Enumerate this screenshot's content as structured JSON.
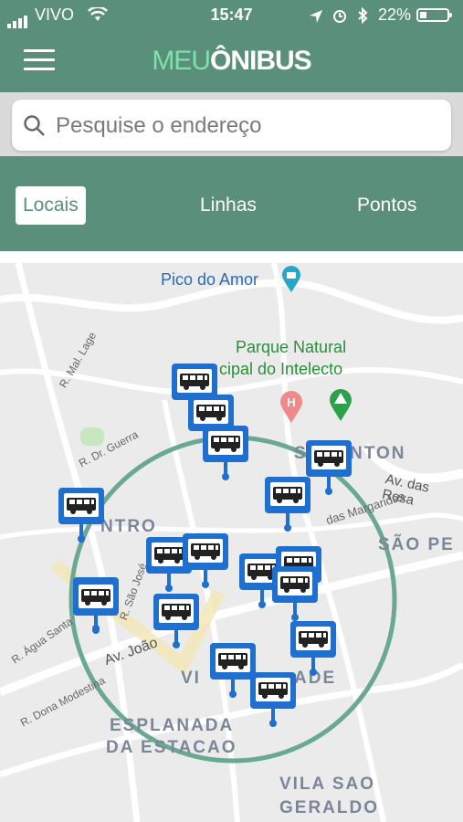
{
  "status_bar": {
    "carrier": "VIVO",
    "time": "15:47",
    "battery_percent": "22%"
  },
  "header": {
    "logo_part1": "MEU",
    "logo_part2": "ÔNIBUS",
    "background": "#5a8f7b",
    "logo_accent": "#7ee2a8"
  },
  "search": {
    "placeholder": "Pesquise o endereço",
    "value": ""
  },
  "tabs": [
    {
      "label": "Locais",
      "active": true
    },
    {
      "label": "Linhas",
      "active": false
    },
    {
      "label": "Pontos",
      "active": false
    }
  ],
  "map": {
    "poi_labels": [
      "Pico do Amor",
      "Parque Natural",
      "cipal do Intelecto"
    ],
    "street_labels": [
      "R. Mal. Lage",
      "R. Dr. Guerra",
      "R. São José",
      "Av. João",
      "R. Água Santa",
      "R. Dona Modestina",
      "Av. das Rosa",
      "das Margaridas"
    ],
    "area_labels": [
      "S  O ANTON",
      "NTRO",
      "SÃO PE",
      "VI",
      "ADE",
      "ESPLANADA",
      "DA ESTACAO",
      "VILA SAO",
      "GERALDO"
    ],
    "bus_stop_color": "#1f6fd1",
    "bus_stop_count": 17
  }
}
